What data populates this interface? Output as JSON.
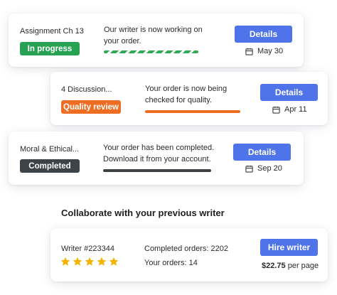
{
  "orders": [
    {
      "name": "Assignment Ch 13",
      "status": "In progress",
      "status_color": "#27a152",
      "message": "Our writer is now working on your order.",
      "progress_color": "#2eab52",
      "button": "Details",
      "date": "May 30"
    },
    {
      "name": "4 Discussion...",
      "status": "Quality review",
      "status_color": "#ee6d22",
      "message": "Your order is now being checked for quality.",
      "progress_color": "#ee6d22",
      "button": "Details",
      "date": "Apr 11"
    },
    {
      "name": "Moral & Ethical...",
      "status": "Completed",
      "status_color": "#3e4347",
      "message": "Your order has been completed. Download it from your account.",
      "progress_color": "#3e4347",
      "button": "Details",
      "date": "Sep 20"
    }
  ],
  "collaborate": {
    "heading": "Collaborate with your previous writer",
    "writer": "Writer #223344",
    "rating": 5,
    "completed_orders": "Completed orders: 2202",
    "your_orders": "Your orders: 14",
    "button": "Hire writer",
    "price": "$22.75",
    "price_unit": "per page",
    "star_color": "#f5b400"
  },
  "colors": {
    "button": "#4f74ea"
  },
  "icons": {
    "date": "calendar-icon",
    "rating": "star-icon"
  }
}
